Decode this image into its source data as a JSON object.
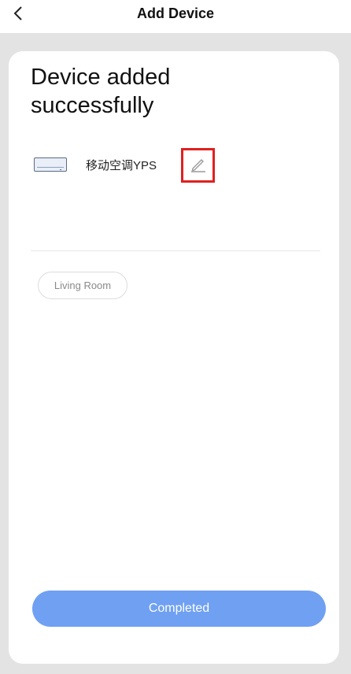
{
  "header": {
    "title": "Add Device",
    "back_icon": "chevron-left-icon"
  },
  "card": {
    "headline": "Device added successfully",
    "device": {
      "icon": "air-conditioner-icon",
      "name": "移动空调YPS",
      "edit_icon": "pencil-icon",
      "edit_highlight_color": "#e02020"
    },
    "room": {
      "label": "Living Room"
    }
  },
  "footer": {
    "completed_label": "Completed",
    "button_color": "#6fa0f2"
  }
}
